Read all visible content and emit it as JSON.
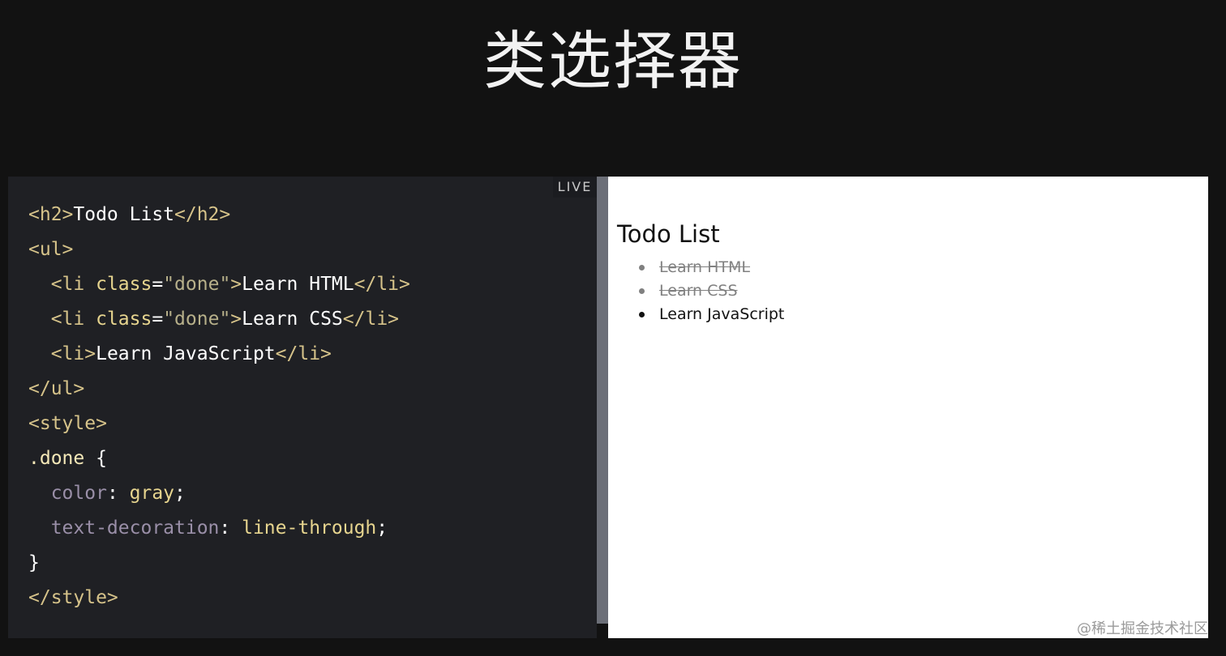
{
  "slide": {
    "title": "类选择器"
  },
  "editor": {
    "live_label": "LIVE",
    "lines": [
      [
        {
          "t": "<h2>",
          "c": "tag"
        },
        {
          "t": "Todo List",
          "c": "text"
        },
        {
          "t": "</h2>",
          "c": "tag"
        }
      ],
      [
        {
          "t": "<ul>",
          "c": "tag"
        }
      ],
      [
        {
          "t": "  <li ",
          "c": "tag"
        },
        {
          "t": "class",
          "c": "attr"
        },
        {
          "t": "=",
          "c": "punc"
        },
        {
          "t": "\"done\"",
          "c": "str"
        },
        {
          "t": ">",
          "c": "tag"
        },
        {
          "t": "Learn HTML",
          "c": "text"
        },
        {
          "t": "</li>",
          "c": "tag"
        }
      ],
      [
        {
          "t": "  <li ",
          "c": "tag"
        },
        {
          "t": "class",
          "c": "attr"
        },
        {
          "t": "=",
          "c": "punc"
        },
        {
          "t": "\"done\"",
          "c": "str"
        },
        {
          "t": ">",
          "c": "tag"
        },
        {
          "t": "Learn CSS",
          "c": "text"
        },
        {
          "t": "</li>",
          "c": "tag"
        }
      ],
      [
        {
          "t": "  <li>",
          "c": "tag"
        },
        {
          "t": "Learn JavaScript",
          "c": "text"
        },
        {
          "t": "</li>",
          "c": "tag"
        }
      ],
      [
        {
          "t": "</ul>",
          "c": "tag"
        }
      ],
      [
        {
          "t": "<style>",
          "c": "tag"
        }
      ],
      [
        {
          "t": ".done",
          "c": "sel"
        },
        {
          "t": " {",
          "c": "punc"
        }
      ],
      [
        {
          "t": "  color",
          "c": "prop"
        },
        {
          "t": ": ",
          "c": "punc"
        },
        {
          "t": "gray",
          "c": "val"
        },
        {
          "t": ";",
          "c": "punc"
        }
      ],
      [
        {
          "t": "  text-decoration",
          "c": "prop"
        },
        {
          "t": ": ",
          "c": "punc"
        },
        {
          "t": "line-through",
          "c": "val"
        },
        {
          "t": ";",
          "c": "punc"
        }
      ],
      [
        {
          "t": "}",
          "c": "punc"
        }
      ],
      [
        {
          "t": "</style>",
          "c": "tag"
        }
      ]
    ]
  },
  "preview": {
    "heading": "Todo List",
    "items": [
      {
        "label": "Learn HTML",
        "done": true
      },
      {
        "label": "Learn CSS",
        "done": true
      },
      {
        "label": "Learn JavaScript",
        "done": false
      }
    ]
  },
  "watermark": "@稀土掘金技术社区",
  "colors": {
    "background": "#121212",
    "editor_bg": "#1f2024",
    "divider": "#6c6f78",
    "tag": "#d6c38a",
    "done_text": "gray"
  }
}
